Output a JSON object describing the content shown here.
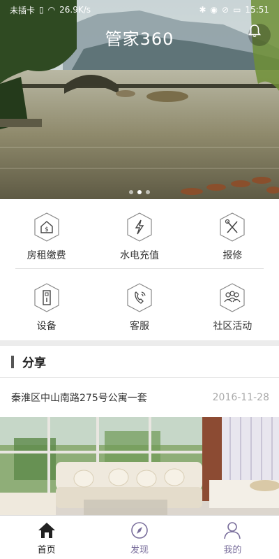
{
  "status_bar": {
    "carrier": "未插卡",
    "speed": "26.9K/s",
    "time": "15:51"
  },
  "header": {
    "title": "管家360"
  },
  "banner": {
    "pages": 3,
    "active_page": 2
  },
  "grid": {
    "items": [
      {
        "label": "房租缴费",
        "icon": "rent-payment-icon"
      },
      {
        "label": "水电充值",
        "icon": "utility-recharge-icon"
      },
      {
        "label": "报修",
        "icon": "repair-tools-icon"
      },
      {
        "label": "设备",
        "icon": "device-door-icon"
      },
      {
        "label": "客服",
        "icon": "customer-service-phone-icon"
      },
      {
        "label": "社区活动",
        "icon": "community-people-icon"
      }
    ]
  },
  "share": {
    "title": "分享",
    "item_title": "秦淮区中山南路275号公寓一套",
    "item_date": "2016-11-28"
  },
  "tabbar": {
    "tabs": [
      {
        "label": "首页",
        "icon": "home-icon",
        "active": true
      },
      {
        "label": "发现",
        "icon": "compass-icon",
        "active": false
      },
      {
        "label": "我的",
        "icon": "user-icon",
        "active": false
      }
    ]
  },
  "colors": {
    "tab_inactive": "#7a6f9c",
    "icon_stroke": "#555555",
    "date": "#aaaaaa"
  }
}
